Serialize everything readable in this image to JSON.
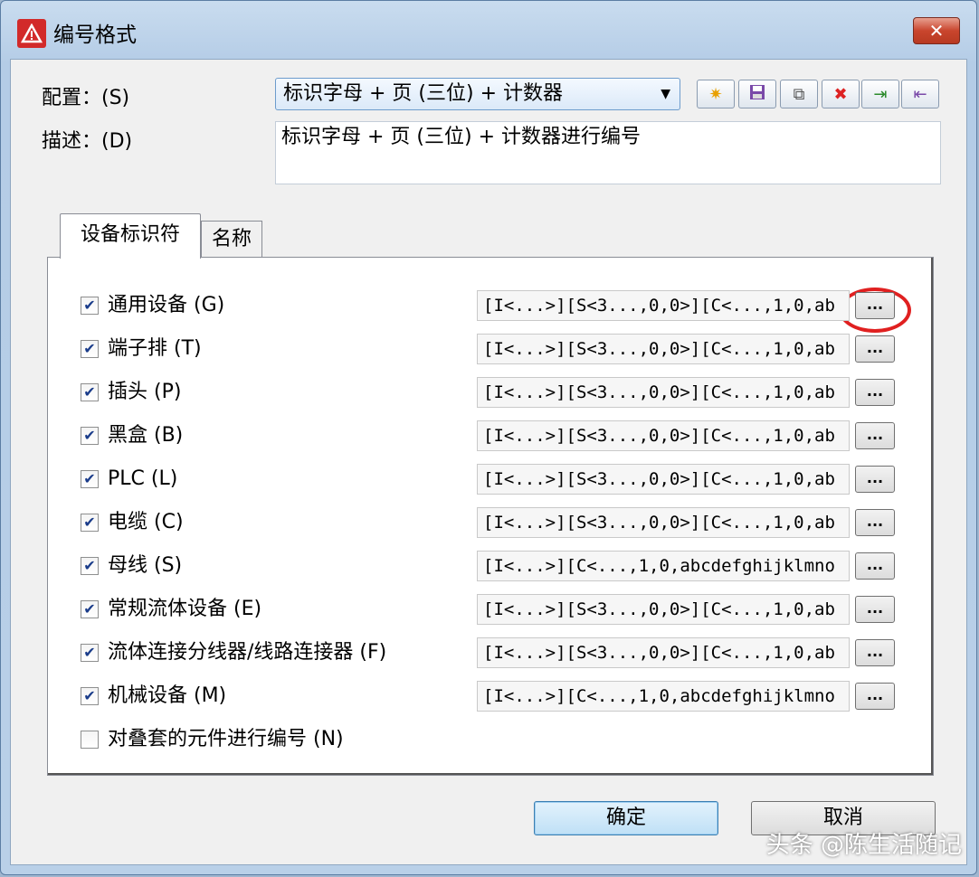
{
  "window": {
    "title": "编号格式",
    "close_label": "✕"
  },
  "config": {
    "label": "配置：(S)",
    "selected": "标识字母 + 页 (三位) + 计数器",
    "arrow": "▼"
  },
  "toolbar": [
    {
      "icon": "new-icon",
      "glyph": "✷"
    },
    {
      "icon": "save-icon",
      "glyph": "💾"
    },
    {
      "icon": "copy-icon",
      "glyph": "⧉"
    },
    {
      "icon": "delete-icon",
      "glyph": "✖"
    },
    {
      "icon": "import-icon",
      "glyph": "⇥"
    },
    {
      "icon": "export-icon",
      "glyph": "⇤"
    }
  ],
  "description": {
    "label": "描述：(D)",
    "value": "标识字母 + 页 (三位) + 计数器进行编号"
  },
  "tabs": {
    "device": "设备标识符",
    "name": "名称"
  },
  "rows": [
    {
      "label": "通用设备 (G)",
      "checked": true,
      "format": "[I<...>][S<3...,0,0>][C<...,1,0,ab"
    },
    {
      "label": "端子排 (T)",
      "checked": true,
      "format": "[I<...>][S<3...,0,0>][C<...,1,0,ab"
    },
    {
      "label": "插头 (P)",
      "checked": true,
      "format": "[I<...>][S<3...,0,0>][C<...,1,0,ab"
    },
    {
      "label": "黑盒 (B)",
      "checked": true,
      "format": "[I<...>][S<3...,0,0>][C<...,1,0,ab"
    },
    {
      "label": "PLC (L)",
      "checked": true,
      "format": "[I<...>][S<3...,0,0>][C<...,1,0,ab"
    },
    {
      "label": "电缆 (C)",
      "checked": true,
      "format": "[I<...>][S<3...,0,0>][C<...,1,0,ab"
    },
    {
      "label": "母线 (S)",
      "checked": true,
      "format": "[I<...>][C<...,1,0,abcdefghijklmno"
    },
    {
      "label": "常规流体设备 (E)",
      "checked": true,
      "format": "[I<...>][S<3...,0,0>][C<...,1,0,ab"
    },
    {
      "label": "流体连接分线器/线路连接器 (F)",
      "checked": true,
      "format": "[I<...>][S<3...,0,0>][C<...,1,0,ab"
    },
    {
      "label": "机械设备 (M)",
      "checked": true,
      "format": "[I<...>][C<...,1,0,abcdefghijklmno"
    },
    {
      "label": "对叠套的元件进行编号 (N)",
      "checked": false,
      "format": null
    }
  ],
  "browse_label": "...",
  "buttons": {
    "ok": "确定",
    "cancel": "取消"
  },
  "watermark": "头条 @陈生活随记"
}
